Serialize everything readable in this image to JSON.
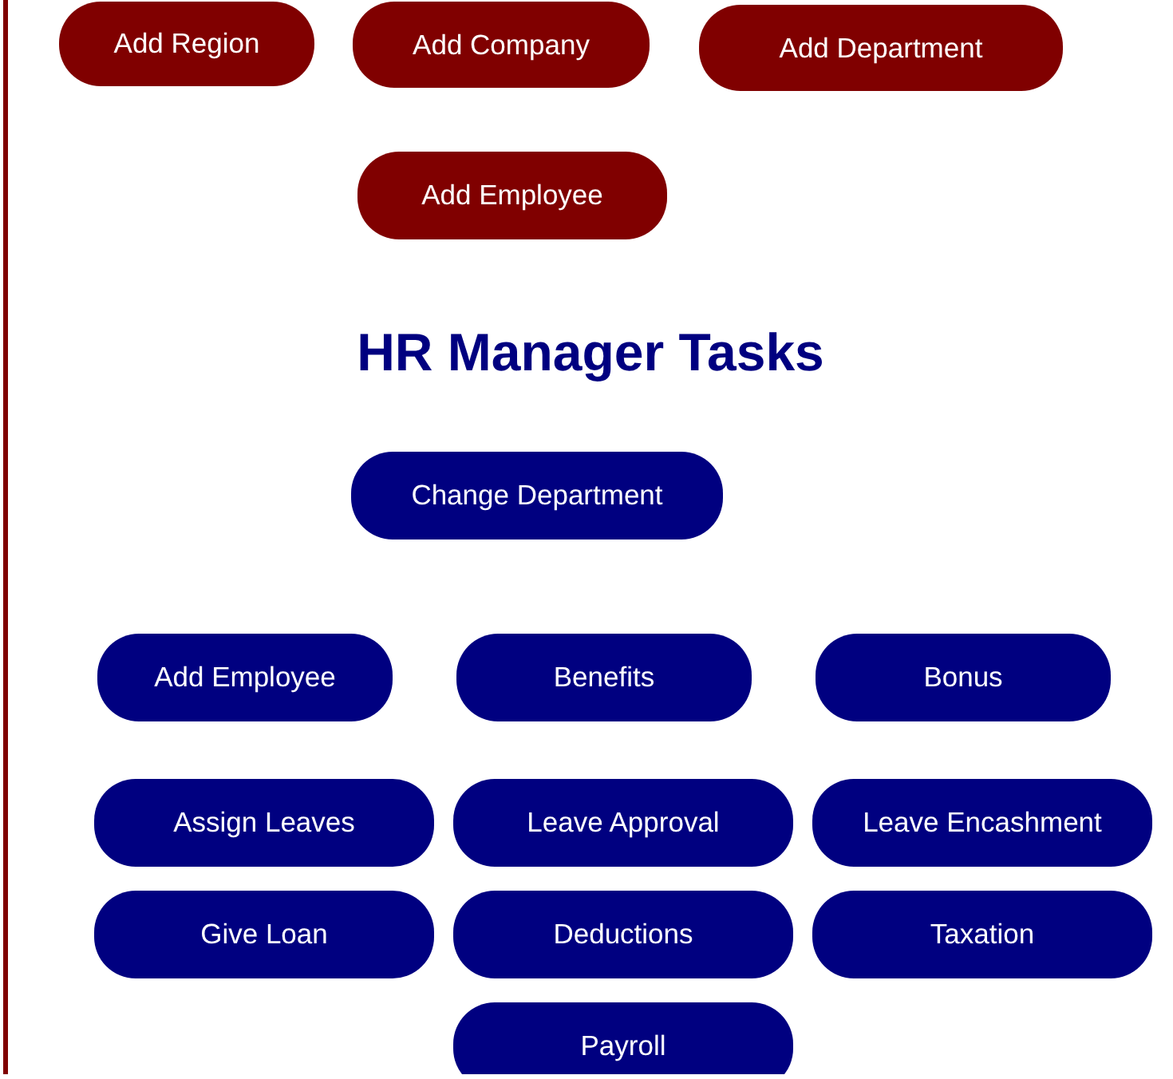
{
  "admin_rows": [
    [
      "Add Region",
      "Add Company",
      "Add Department"
    ],
    [
      "Add Employee"
    ]
  ],
  "title": "HR Manager Tasks",
  "task_rows": [
    [
      "Change Department"
    ],
    [
      "Add Employee",
      "Benefits",
      "Bonus"
    ],
    [
      "Assign Leaves",
      "Leave Approval",
      "Leave Encashment"
    ],
    [
      "Give Loan",
      "Deductions",
      "Taxation"
    ],
    [
      "Payroll"
    ]
  ]
}
